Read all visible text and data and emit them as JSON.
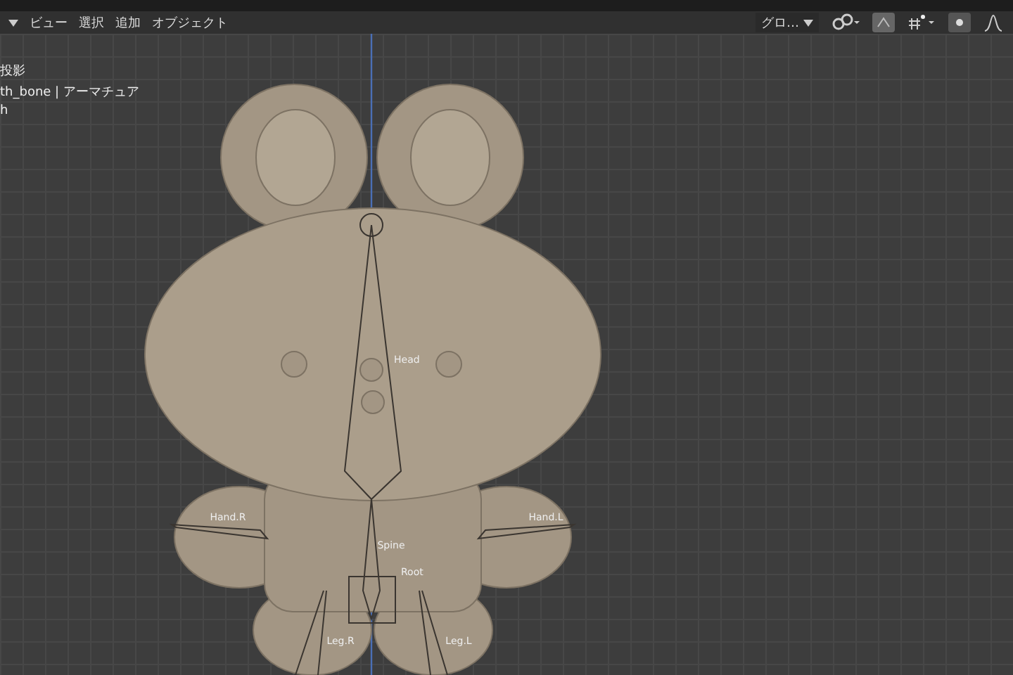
{
  "header": {
    "menus": [
      "ビュー",
      "選択",
      "追加",
      "オブジェクト"
    ],
    "orientation": "グロ…"
  },
  "overlay": {
    "lines": [
      "投影",
      "th_bone | アーマチュア",
      "h"
    ]
  },
  "bones": [
    {
      "label": "Head"
    },
    {
      "label": "Hand.R"
    },
    {
      "label": "Hand.L"
    },
    {
      "label": "Spine"
    },
    {
      "label": "Root"
    },
    {
      "label": "Leg.R"
    },
    {
      "label": "Leg.L"
    }
  ]
}
